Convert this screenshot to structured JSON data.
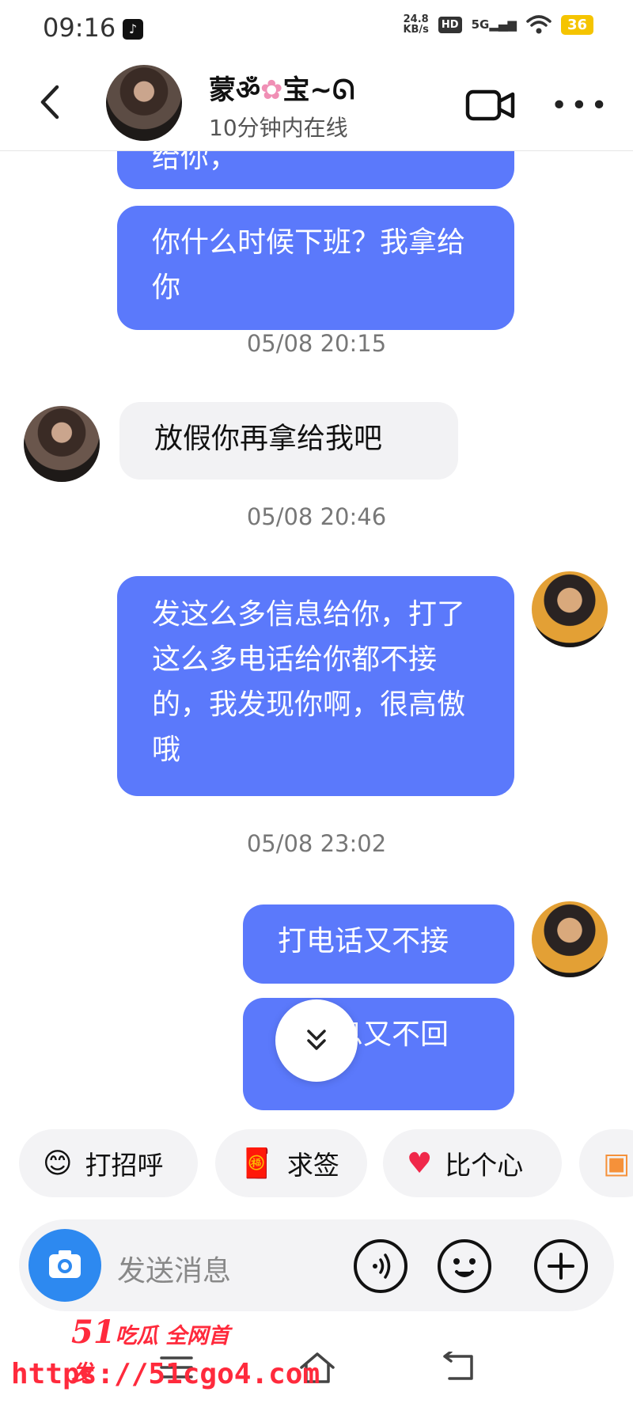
{
  "status_bar": {
    "time": "09:16",
    "app_icon": "tiktok-icon",
    "speed_value": "24.8",
    "speed_unit": "KB/s",
    "hd_badge": "HD",
    "network": "5G",
    "battery": "36"
  },
  "header": {
    "contact_name": "蒙",
    "contact_name_end": "宝",
    "presence": "10分钟内在线",
    "icons": [
      "back-arrow-icon",
      "video-call-icon",
      "more-icon"
    ]
  },
  "messages": [
    {
      "direction": "out",
      "text": "给你，"
    },
    {
      "direction": "out",
      "text": "你什么时候下班？我拿给你"
    },
    {
      "type": "timestamp",
      "text": "05/08 20:15"
    },
    {
      "direction": "in",
      "text": "放假你再拿给我吧"
    },
    {
      "type": "timestamp",
      "text": "05/08 20:46"
    },
    {
      "direction": "out",
      "text": "发这么多信息给你，打了这么多电话给你都不接的，我发现你啊，很高傲哦"
    },
    {
      "type": "timestamp",
      "text": "05/08 23:02"
    },
    {
      "direction": "out",
      "text": "打电话又不接"
    },
    {
      "direction": "out",
      "text": "发信息又不回"
    }
  ],
  "quick_actions": [
    {
      "label": "打招呼",
      "icon": "smile-emoji-icon"
    },
    {
      "label": "求签",
      "icon": "fortune-sticks-icon"
    },
    {
      "label": "比个心",
      "icon": "heart-icon"
    },
    {
      "label": "",
      "icon": "group-icon"
    }
  ],
  "input": {
    "placeholder": "发送消息",
    "buttons": [
      "camera-icon",
      "voice-icon",
      "emoji-icon",
      "plus-icon"
    ]
  },
  "watermark": {
    "brand_number": "51",
    "brand_text": "吃瓜 全网首发",
    "url": "https://51cgo4.com"
  },
  "colors": {
    "outgoing_bubble": "#5b79fb",
    "incoming_bubble": "#f2f2f4",
    "battery": "#f5c400",
    "camera_button": "#2d89f0",
    "watermark": "#ff2a3c"
  }
}
